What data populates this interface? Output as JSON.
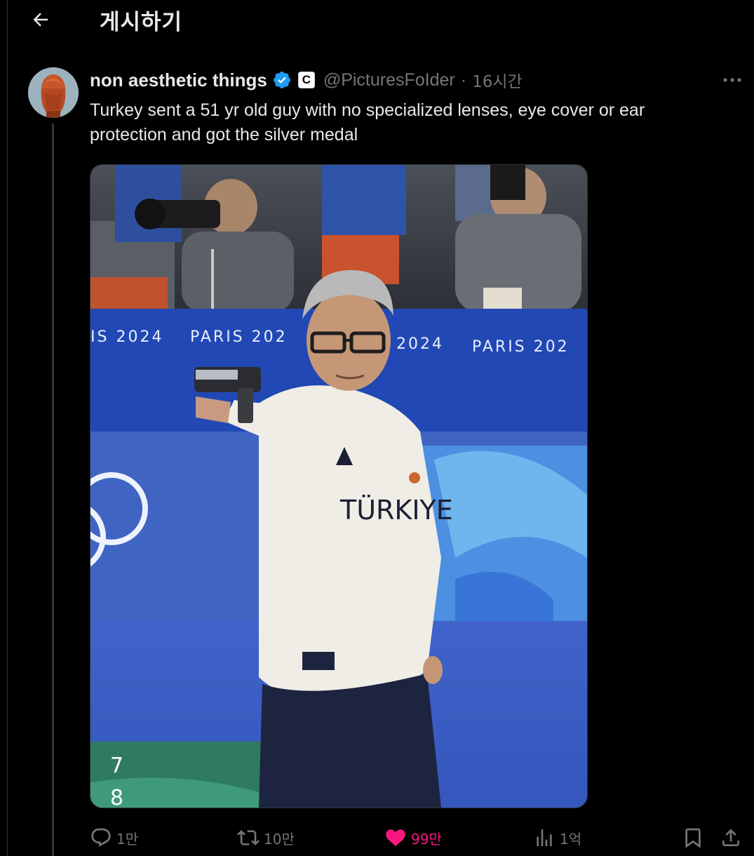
{
  "header": {
    "title": "게시하기",
    "back_icon": "arrow-left-icon"
  },
  "post": {
    "author": {
      "display_name": "non aesthetic things",
      "handle": "@PicturesFoIder",
      "verified": true,
      "affiliation_badge": "C",
      "avatar_icon": "avatar-image"
    },
    "separator": "·",
    "time": "16시간",
    "text": "Turkey sent a 51 yr old guy with no specialized lenses, eye cover or ear protection and got the silver medal",
    "media": {
      "banner_text_left": "IS 2024",
      "banner_text_mid": "PARIS 202",
      "banner_text_right": "2024",
      "banner_text_far": "PARIS 202",
      "shirt_text": "TÜRKIYE",
      "score_top": "7",
      "score_bottom": "8"
    },
    "actions": {
      "reply_count": "1만",
      "repost_count": "10만",
      "like_count": "99만",
      "views_count": "1억",
      "liked": true
    }
  },
  "colors": {
    "background": "#000000",
    "text_primary": "#e7e9ea",
    "text_secondary": "#71767b",
    "verified_blue": "#1d9bf0",
    "like_pink": "#f91880",
    "divider": "#2f3336"
  }
}
